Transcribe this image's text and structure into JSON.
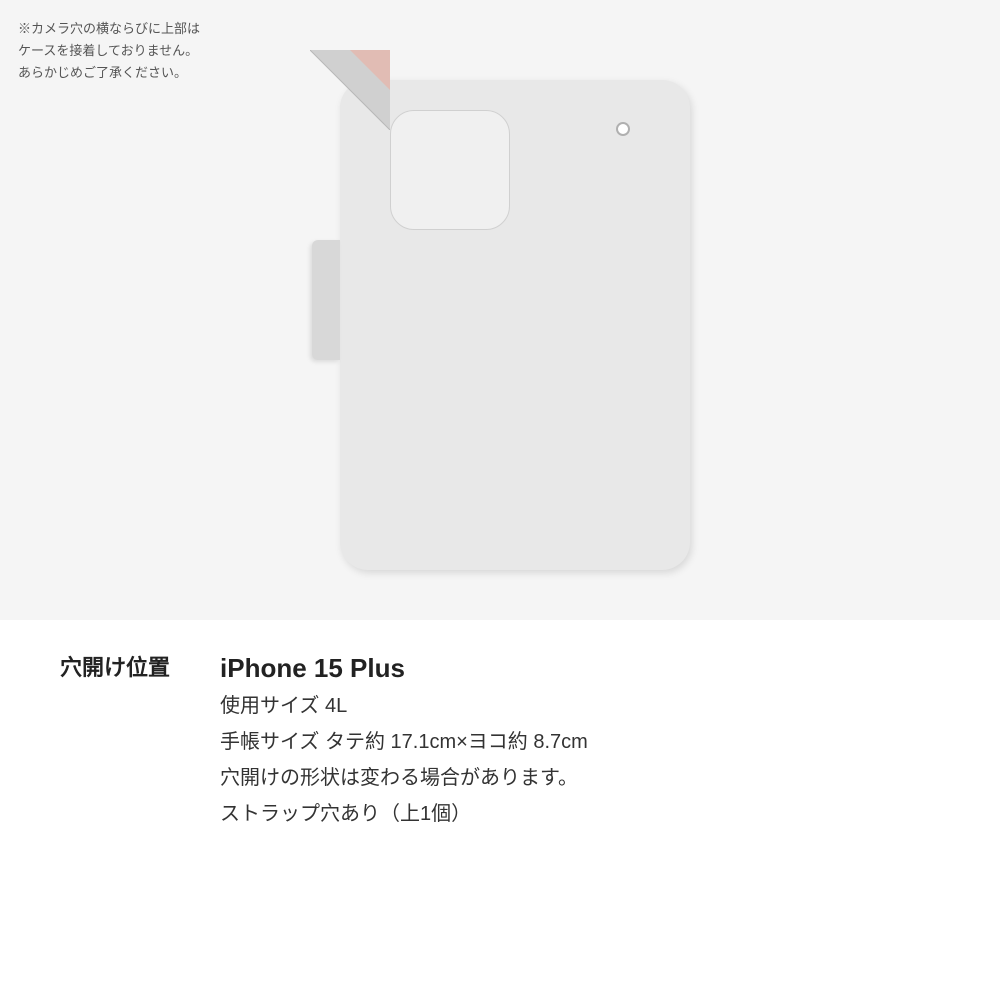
{
  "page": {
    "background": "#f5f5f5"
  },
  "note": {
    "line1": "※カメラ穴の横ならびに上部は",
    "line2": "ケースを接着しておりません。",
    "line3": "あらかじめご了承ください。"
  },
  "case": {
    "body_color": "#e8e8e8",
    "spine_color": "#d8d8d8"
  },
  "info": {
    "label": "穴開け位置",
    "device_name": "iPhone 15 Plus",
    "spec1": "使用サイズ 4L",
    "spec2": "手帳サイズ タテ約 17.1cm×ヨコ約 8.7cm",
    "spec3": "穴開けの形状は変わる場合があります。",
    "spec4": "ストラップ穴あり（上1個）"
  }
}
